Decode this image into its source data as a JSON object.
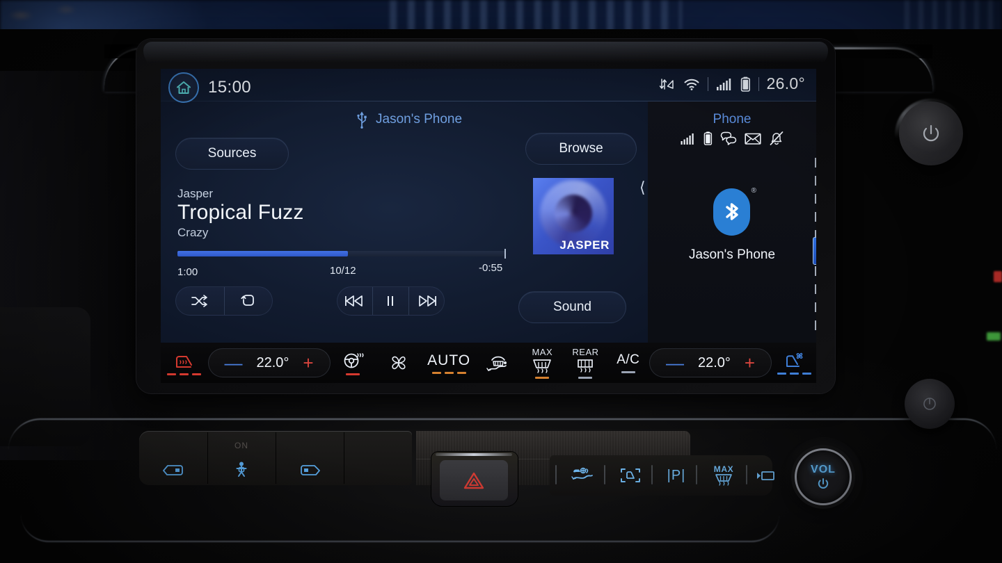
{
  "screen": {
    "status_bar": {
      "clock": "15:00",
      "home_icon": "home-icon",
      "icons": [
        "data-transfer-icon",
        "wifi-icon",
        "cellular-signal-icon",
        "battery-icon"
      ],
      "outside_temperature": "26.0°"
    },
    "source_bar": {
      "usb_icon": "usb-icon",
      "device_label": "Jason's Phone"
    },
    "buttons": {
      "sources": "Sources",
      "browse": "Browse",
      "sound": "Sound"
    },
    "now_playing": {
      "artist": "Jasper",
      "title": "Tropical Fuzz",
      "album": "Crazy",
      "elapsed": "1:00",
      "track_position": "10/12",
      "remaining": "-0:55",
      "progress_percent": 52,
      "album_art_label": "JASPER",
      "next_art_chevron": "chevron-left-icon"
    },
    "transport": {
      "shuffle": "shuffle-icon",
      "repeat": "repeat-icon",
      "previous": "previous-track-icon",
      "play_pause": "pause-icon",
      "next": "next-track-icon"
    },
    "phone_panel": {
      "title": "Phone",
      "status_icons": [
        "cellular-signal-icon",
        "battery-icon",
        "messages-icon",
        "mail-icon",
        "notifications-muted-icon"
      ],
      "bluetooth_icon": "bluetooth-icon",
      "bluetooth_trademark": "®",
      "device_name": "Jason's Phone",
      "title_color": "#5c8fe0",
      "bluetooth_color": "#2a7fd4"
    },
    "scrollbar": {
      "name": "page-scrollbar"
    }
  },
  "climate_bar": {
    "driver_heated_seat": {
      "icon": "heated-seat-icon",
      "level_dashes": 3,
      "color": "#d5392f"
    },
    "driver_temp": {
      "minus": "—",
      "value": "22.0°",
      "plus": "+"
    },
    "heated_steering_wheel": {
      "icon": "heated-steering-wheel-icon",
      "active": true,
      "color": "#d5392f"
    },
    "fan": {
      "icon": "fan-icon"
    },
    "auto": {
      "label": "AUTO",
      "level_dashes": 3,
      "color": "#d4802f"
    },
    "front_defrost": {
      "icon": "front-defrost-icon"
    },
    "max_defrost": {
      "label": "MAX",
      "icon": "max-defrost-icon",
      "color": "#d4802f"
    },
    "rear_defrost": {
      "label": "REAR",
      "icon": "rear-defrost-icon"
    },
    "ac": {
      "label": "A/C"
    },
    "passenger_temp": {
      "minus": "—",
      "value": "22.0°",
      "plus": "+"
    },
    "passenger_ventilated_seat": {
      "icon": "ventilated-seat-icon",
      "level_dashes": 3,
      "color": "#3f7fd8"
    }
  },
  "console": {
    "left_buttons": [
      {
        "name": "rear-window-lock-button",
        "icon": "window-lock-icon",
        "label": ""
      },
      {
        "name": "child-lock-button",
        "icon": "child-lock-icon",
        "label": "ON"
      },
      {
        "name": "power-window-button",
        "icon": "power-window-icon",
        "label": ""
      }
    ],
    "hazard_button": {
      "name": "hazard-lights-button",
      "icon": "hazard-triangle-icon",
      "color": "#d23b33"
    },
    "right_buttons": [
      {
        "name": "lane-keeping-button",
        "icon": "lane-keeping-icon"
      },
      {
        "name": "surround-camera-button",
        "icon": "surround-camera-icon"
      },
      {
        "name": "park-assist-button",
        "icon": "park-assist-icon",
        "label": "|P|"
      },
      {
        "name": "max-defrost-button",
        "icon": "max-defrost-icon",
        "label": "MAX"
      },
      {
        "name": "display-off-button",
        "icon": "display-off-icon"
      }
    ],
    "volume_knob": {
      "label": "VOL",
      "icon": "power-icon",
      "color": "#63b7f0"
    },
    "power_knob": {
      "icon": "power-icon"
    },
    "aux_knob": {
      "icon": "drive-mode-icon"
    }
  }
}
